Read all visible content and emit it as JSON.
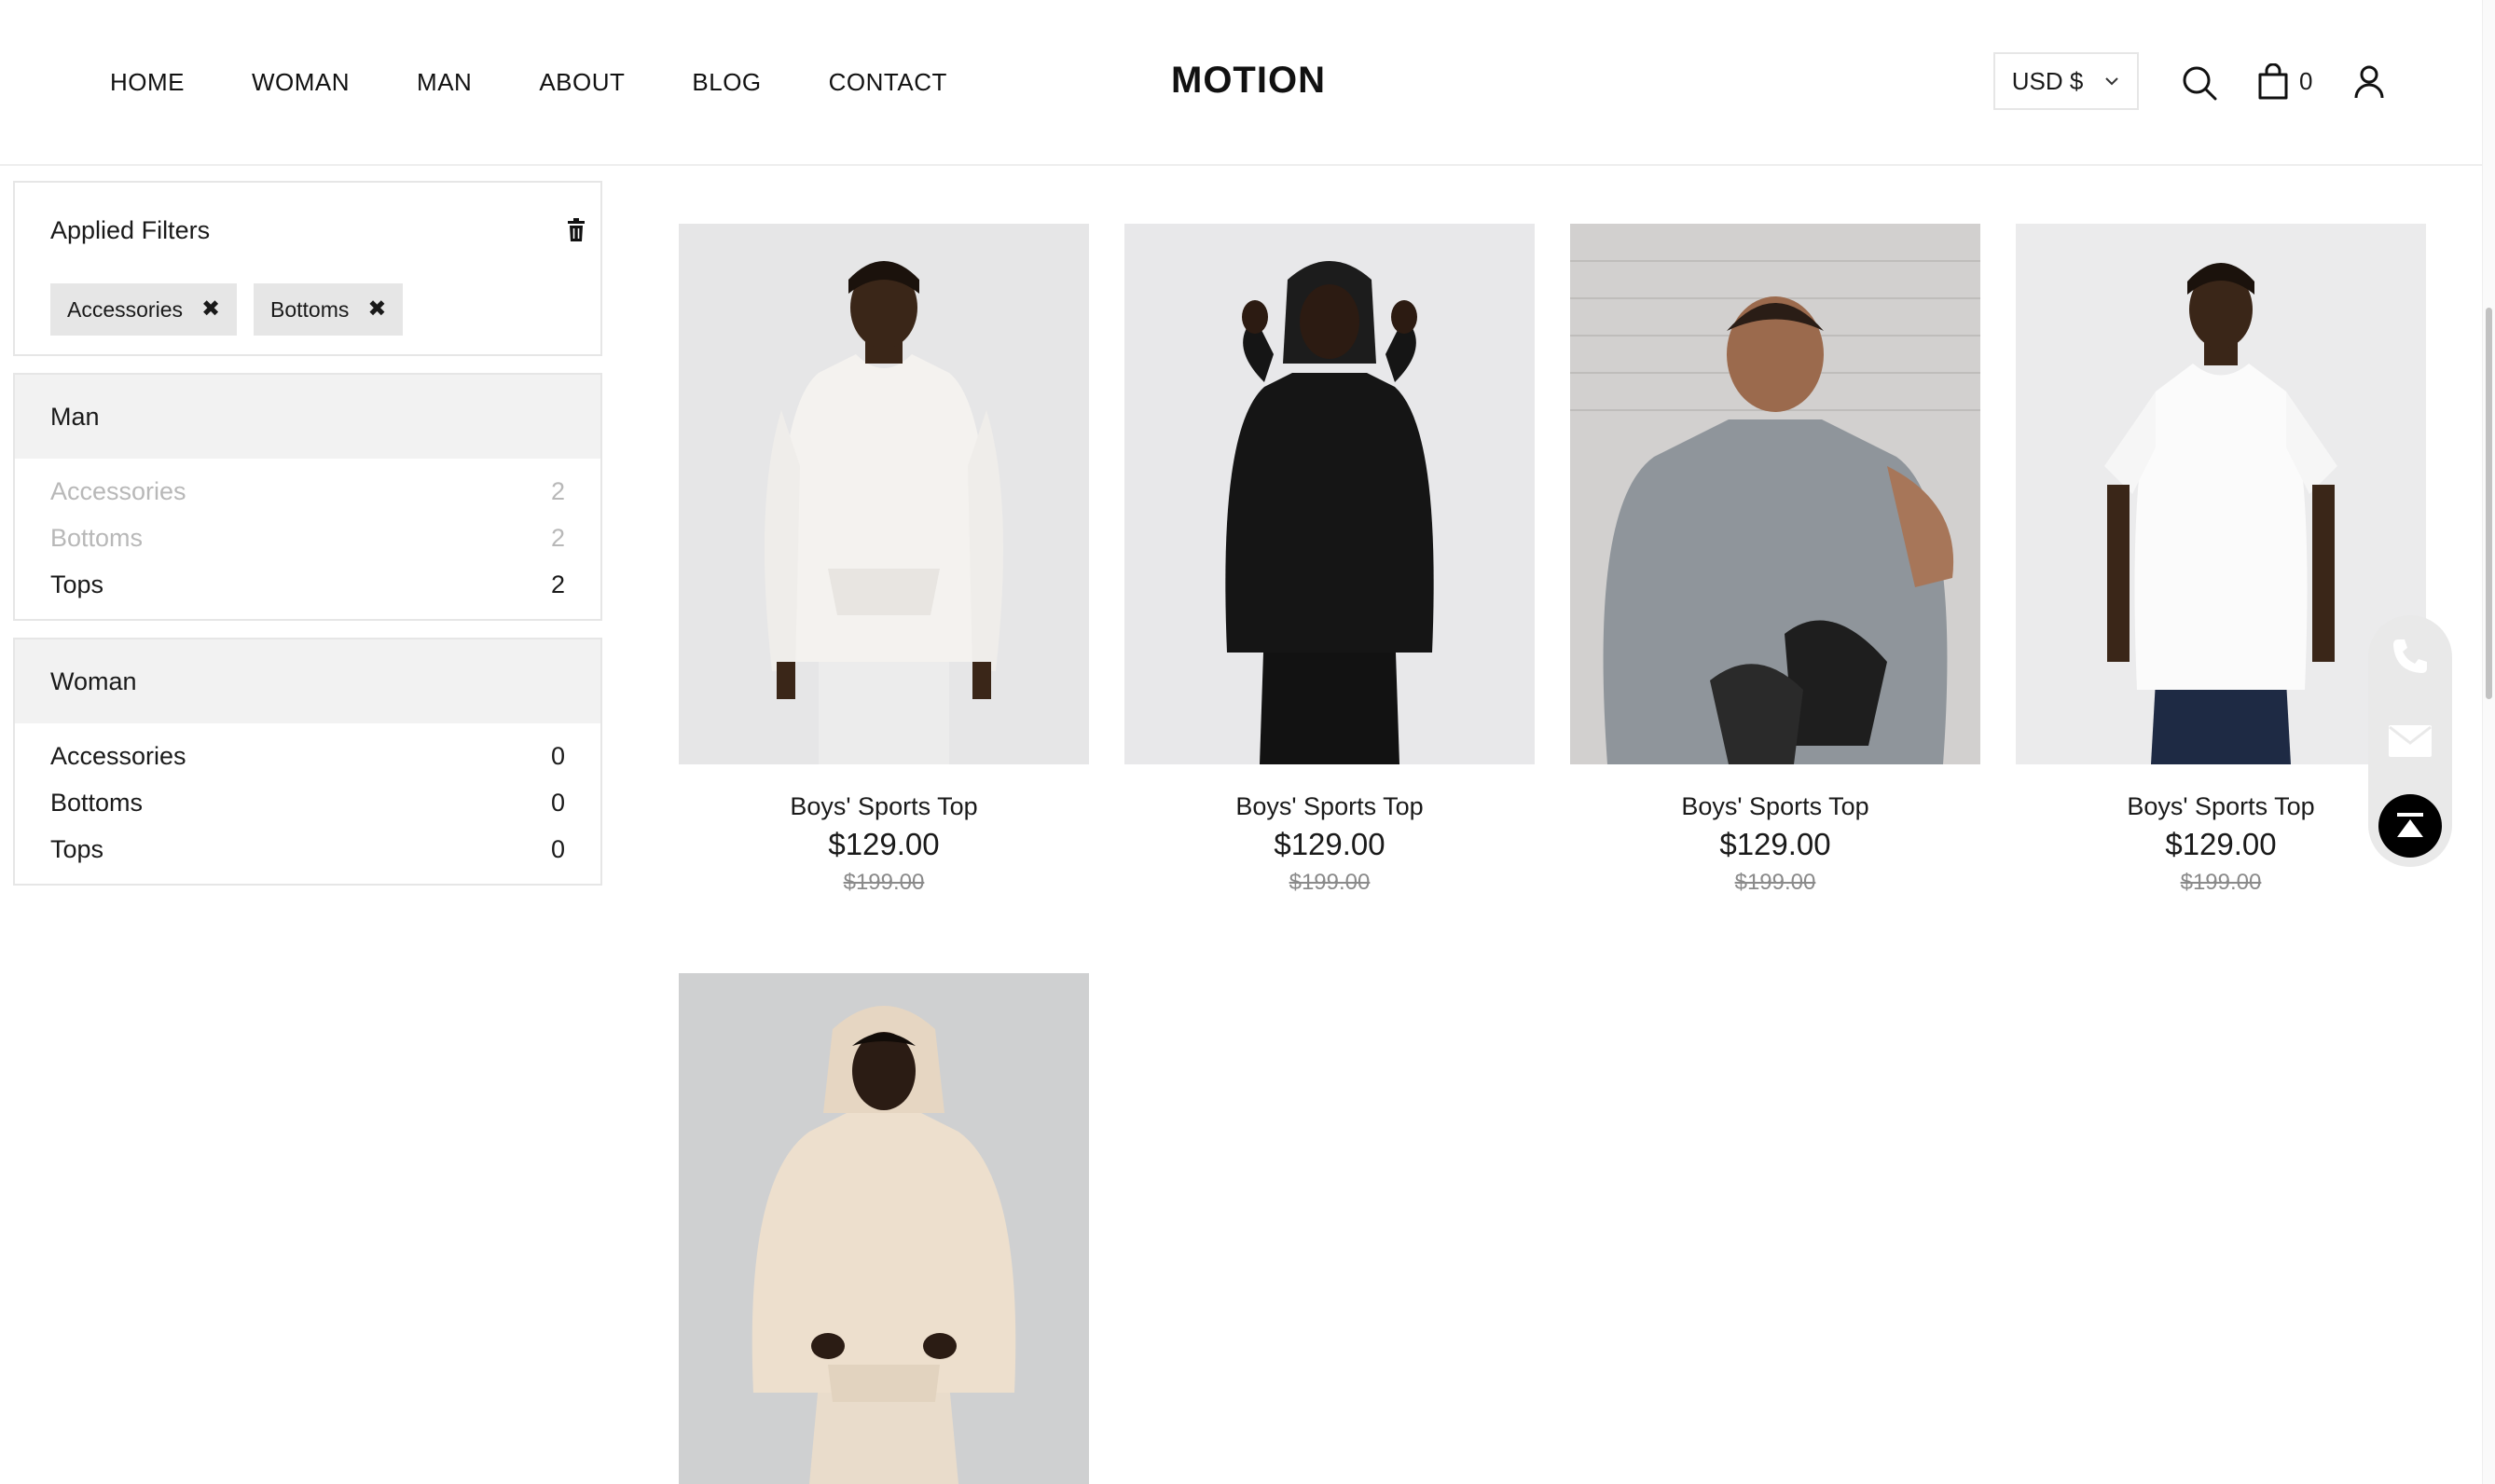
{
  "header": {
    "nav": [
      "HOME",
      "WOMAN",
      "MAN",
      "ABOUT",
      "BLOG",
      "CONTACT"
    ],
    "logo": "MOTION",
    "currency": "USD $",
    "cart_count": "0"
  },
  "filters": {
    "applied_title": "Applied Filters",
    "applied": [
      "Accessories",
      "Bottoms"
    ],
    "groups": [
      {
        "title": "Man",
        "items": [
          {
            "label": "Accessories",
            "count": "2",
            "disabled": true
          },
          {
            "label": "Bottoms",
            "count": "2",
            "disabled": true
          },
          {
            "label": "Tops",
            "count": "2",
            "disabled": false
          }
        ]
      },
      {
        "title": "Woman",
        "items": [
          {
            "label": "Accessories",
            "count": "0",
            "disabled": false
          },
          {
            "label": "Bottoms",
            "count": "0",
            "disabled": false
          },
          {
            "label": "Tops",
            "count": "0",
            "disabled": false
          }
        ]
      }
    ]
  },
  "products": [
    {
      "name": "Boys' Sports Top",
      "price": "$129.00",
      "old_price": "$199.00"
    },
    {
      "name": "Boys' Sports Top",
      "price": "$129.00",
      "old_price": "$199.00"
    },
    {
      "name": "Boys' Sports Top",
      "price": "$129.00",
      "old_price": "$199.00"
    },
    {
      "name": "Boys' Sports Top",
      "price": "$129.00",
      "old_price": "$199.00"
    },
    {
      "name": "",
      "price": "",
      "old_price": ""
    }
  ],
  "colors": {
    "accent": "#000000",
    "panel_head": "#f2f2f2",
    "chip": "#e6e6e6",
    "disabled_text": "#b8b8b8"
  },
  "icons": [
    "search-icon",
    "cart-icon",
    "user-icon",
    "trash-icon",
    "close-icon",
    "phone-icon",
    "mail-icon",
    "back-to-top-icon",
    "chevron-down-icon"
  ]
}
